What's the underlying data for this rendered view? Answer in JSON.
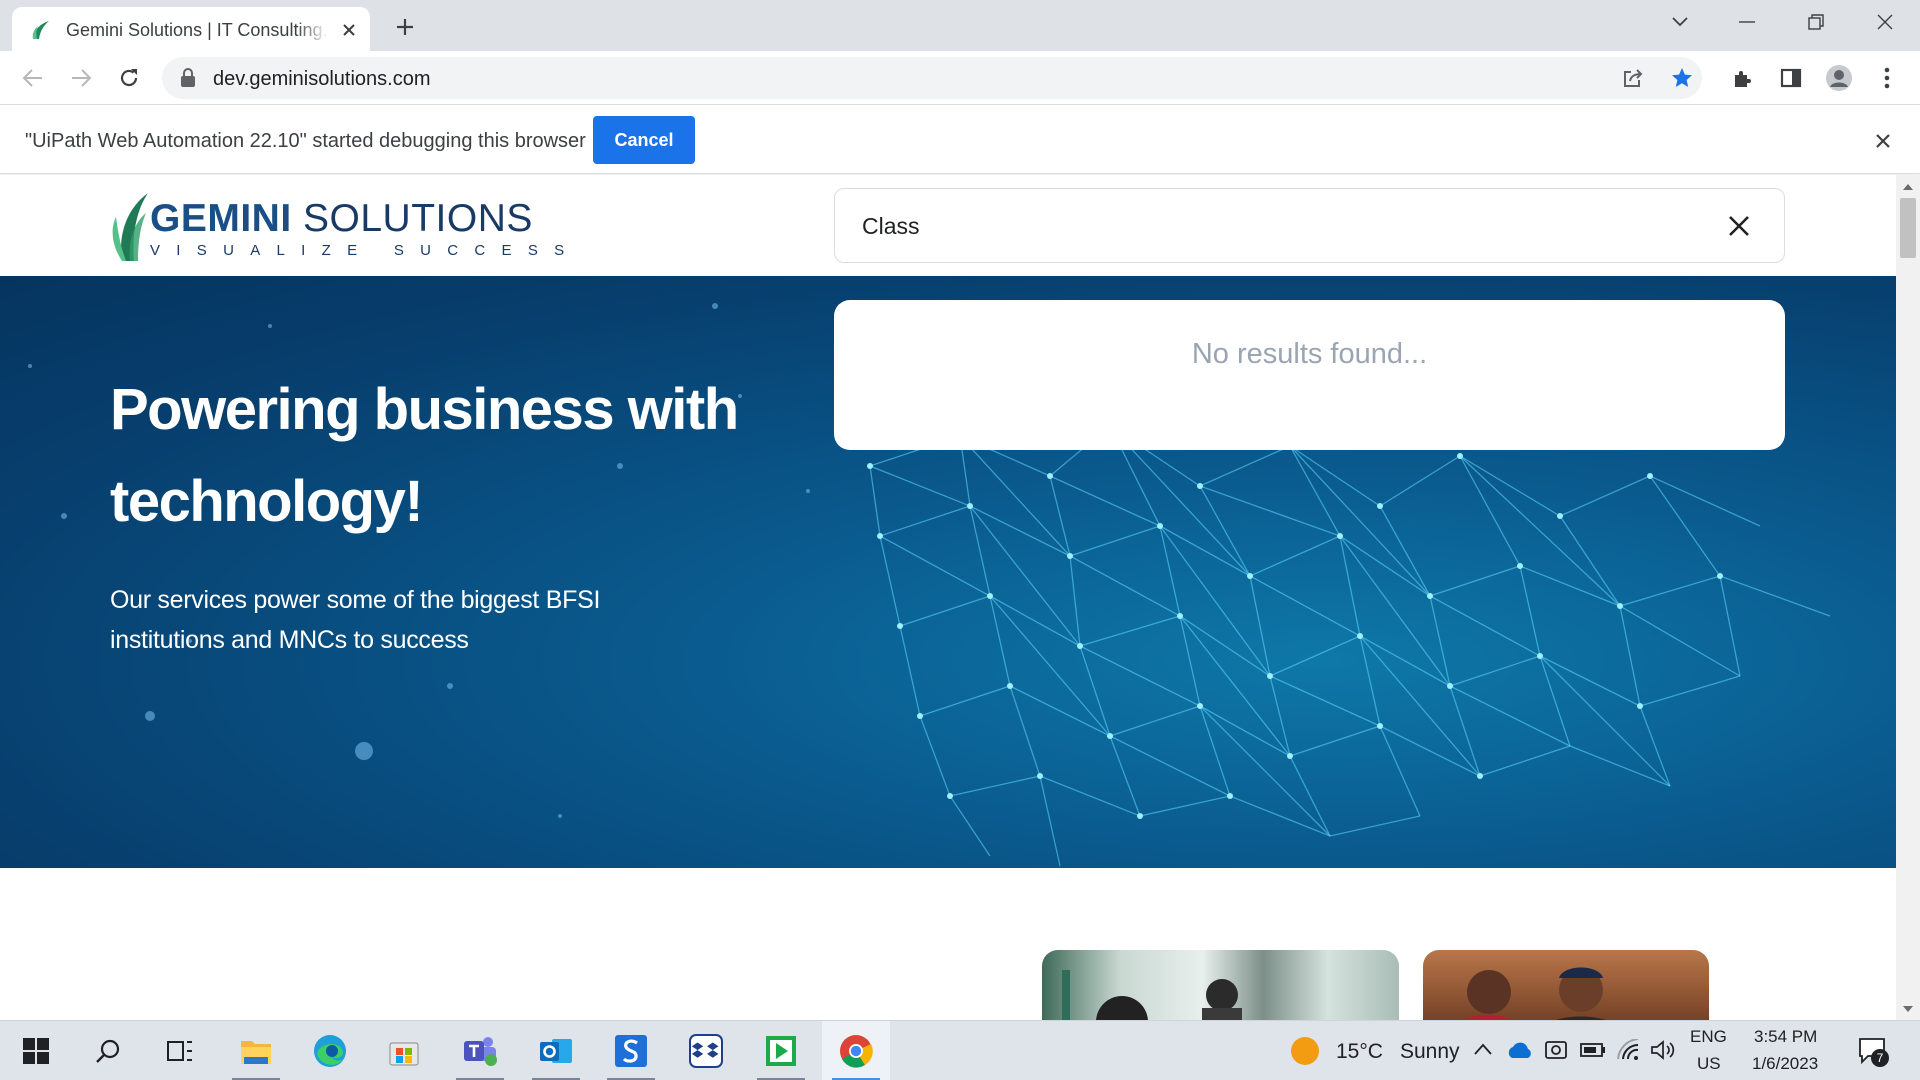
{
  "browser": {
    "tab_title": "Gemini Solutions | IT Consulting, Software Development",
    "url": "dev.geminisolutions.com"
  },
  "infobar": {
    "message": "\"UiPath Web Automation 22.10\" started debugging this browser",
    "cancel_label": "Cancel"
  },
  "site": {
    "logo_text_1": "GEMINI",
    "logo_text_2": "SOLUTIONS",
    "logo_tagline": "VISUALIZE SUCCESS",
    "search_value": "Class",
    "no_results": "No results found...",
    "hero_title": "Powering business with technology!",
    "hero_subtitle": "Our services power some of the biggest BFSI institutions and MNCs to success"
  },
  "taskbar": {
    "weather_temp": "15°C",
    "weather_desc": "Sunny",
    "lang_1": "ENG",
    "lang_2": "US",
    "time": "3:54 PM",
    "date": "1/6/2023",
    "notification_count": "7",
    "apps": [
      "file-explorer",
      "edge",
      "microsoft-store",
      "teams",
      "outlook",
      "app-s",
      "app-dropbox",
      "app-green",
      "chrome"
    ]
  },
  "colors": {
    "accent": "#1a73e8",
    "hero_dark": "#06345f",
    "hero_light": "#0e78a8",
    "logo_blue": "#1a4f86"
  }
}
